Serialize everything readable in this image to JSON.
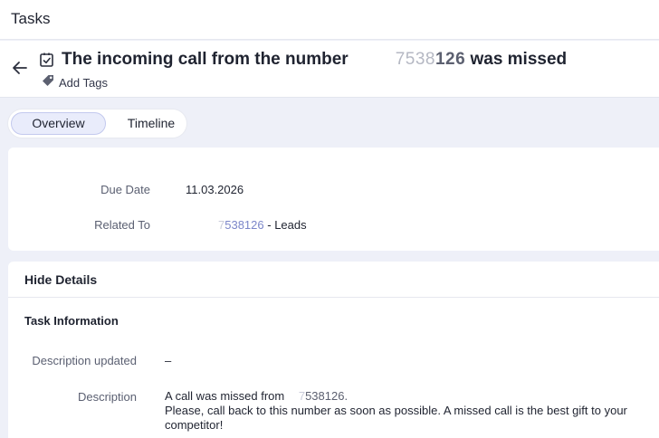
{
  "app": {
    "title": "Tasks"
  },
  "task": {
    "title_prefix": "The incoming call from the number",
    "number_faded": "7538",
    "number_tail": "126",
    "title_suffix": "was missed",
    "add_tags_label": "Add Tags"
  },
  "tabs": [
    {
      "label": "Overview",
      "active": true
    },
    {
      "label": "Timeline",
      "active": false
    }
  ],
  "overview": {
    "due_date_label": "Due Date",
    "due_date_value": "11.03.2026",
    "related_label": "Related To",
    "related_number_faded": "7",
    "related_number": "538126",
    "related_suffix": "- Leads"
  },
  "details": {
    "hide_label": "Hide Details",
    "section_title": "Task Information",
    "desc_updated_label": "Description updated",
    "desc_updated_value": "–",
    "description_label": "Description",
    "description_line1_prefix": "A call was missed from",
    "description_number_faded": "7",
    "description_number": "538126.",
    "description_line2": "Please, call back to this number as soon as possible. A missed call is the best gift to your competitor!"
  },
  "colors": {
    "accent": "#7b86c9",
    "tab_active_bg": "#e9ecfb",
    "page_bg": "#eef0f8"
  },
  "icons": [
    "back-arrow-icon",
    "task-checkbox-icon",
    "tag-icon"
  ]
}
